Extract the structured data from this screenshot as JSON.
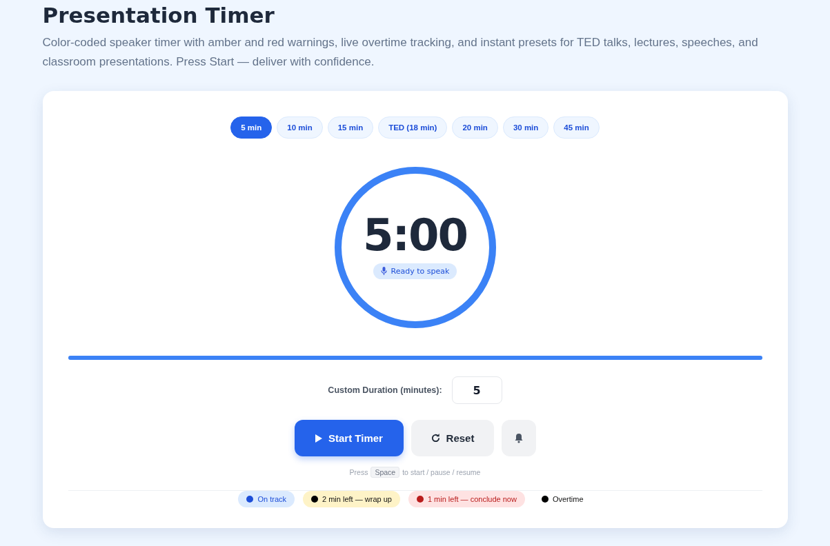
{
  "title": "Presentation Timer",
  "description": "Color-coded speaker timer with amber and red warnings, live overtime tracking, and instant presets for TED talks, lectures, speeches, and classroom presentations. Press Start — deliver with confidence.",
  "presets": [
    {
      "label": "5 min",
      "selected": true
    },
    {
      "label": "10 min",
      "selected": false
    },
    {
      "label": "15 min",
      "selected": false
    },
    {
      "label": "TED (18 min)",
      "selected": false
    },
    {
      "label": "20 min",
      "selected": false
    },
    {
      "label": "30 min",
      "selected": false
    },
    {
      "label": "45 min",
      "selected": false
    }
  ],
  "timer": {
    "time": "5:00",
    "status": "Ready to speak",
    "level": 1
  },
  "progress": {
    "level": 1
  },
  "custom_duration": {
    "label": "Custom Duration (minutes):",
    "value": "5"
  },
  "buttons": {
    "start": "Start Timer",
    "reset": "Reset"
  },
  "hint": {
    "before": "Press",
    "key": "Space",
    "after": "to start / pause / resume"
  },
  "legend": [
    {
      "kind": "track",
      "label": "On track",
      "color": "#1d4ed8"
    },
    {
      "kind": "warn",
      "label": "2 min left — wrap up",
      "color": "#000000"
    },
    {
      "kind": "danger",
      "label": "1 min left — conclude now",
      "color": "#b91c1c"
    },
    {
      "kind": "overtime",
      "label": "Overtime",
      "color": "#000000"
    }
  ]
}
